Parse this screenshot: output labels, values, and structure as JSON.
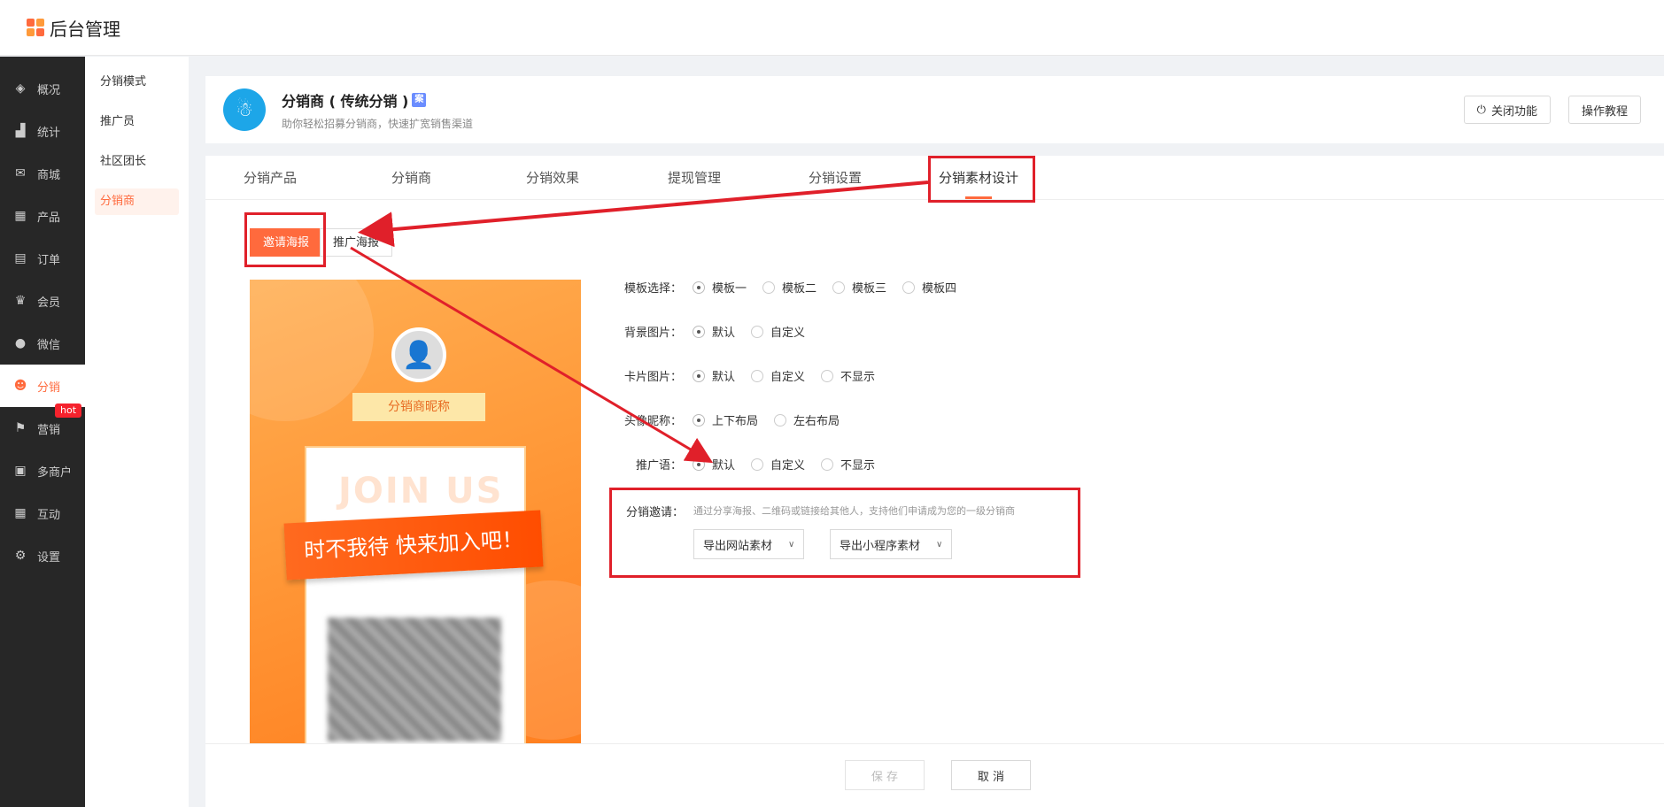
{
  "app": {
    "title": "后台管理"
  },
  "sidebar": {
    "items": [
      {
        "label": "概况",
        "icon": "layers-icon"
      },
      {
        "label": "统计",
        "icon": "chart-icon"
      },
      {
        "label": "商城",
        "icon": "mail-icon"
      },
      {
        "label": "产品",
        "icon": "grid-icon"
      },
      {
        "label": "订单",
        "icon": "clipboard-icon"
      },
      {
        "label": "会员",
        "icon": "crown-icon"
      },
      {
        "label": "微信",
        "icon": "wechat-icon"
      },
      {
        "label": "分销",
        "icon": "user-share-icon",
        "active": true
      },
      {
        "label": "营销",
        "icon": "flag-icon",
        "badge": "hot"
      },
      {
        "label": "多商户",
        "icon": "store-icon"
      },
      {
        "label": "互动",
        "icon": "grid-icon"
      },
      {
        "label": "设置",
        "icon": "gear-icon"
      }
    ]
  },
  "subnav": {
    "items": [
      {
        "label": "分销模式"
      },
      {
        "label": "推广员"
      },
      {
        "label": "社区团长"
      },
      {
        "label": "分销商",
        "active": true
      }
    ]
  },
  "header": {
    "title": "分销商 ( 传统分销 )",
    "badge": "案",
    "subtitle": "助你轻松招募分销商，快速扩宽销售渠道",
    "close_btn": "关闭功能",
    "tutorial_btn": "操作教程"
  },
  "tabs": [
    {
      "label": "分销产品"
    },
    {
      "label": "分销商"
    },
    {
      "label": "分销效果"
    },
    {
      "label": "提现管理"
    },
    {
      "label": "分销设置"
    },
    {
      "label": "分销素材设计",
      "active": true
    }
  ],
  "poster_tabs": [
    {
      "label": "邀请海报",
      "active": true
    },
    {
      "label": "推广海报"
    }
  ],
  "preview": {
    "nickname": "分销商昵称",
    "join": "JOIN US",
    "slogan": "时不我待 快来加入吧！"
  },
  "form": {
    "template": {
      "label": "模板选择：",
      "options": [
        "模板一",
        "模板二",
        "模板三",
        "模板四"
      ],
      "selected": 0
    },
    "bg_image": {
      "label": "背景图片：",
      "options": [
        "默认",
        "自定义"
      ],
      "selected": 0
    },
    "card_image": {
      "label": "卡片图片：",
      "options": [
        "默认",
        "自定义",
        "不显示"
      ],
      "selected": 0
    },
    "avatar_nick": {
      "label": "头像昵称：",
      "options": [
        "上下布局",
        "左右布局"
      ],
      "selected": 0
    },
    "slogan": {
      "label": "推广语：",
      "options": [
        "默认",
        "自定义",
        "不显示"
      ],
      "selected": 0
    },
    "invite": {
      "label": "分销邀请：",
      "desc": "通过分享海报、二维码或链接给其他人，支持他们申请成为您的一级分销商",
      "export_site": "导出网站素材",
      "export_mini": "导出小程序素材"
    }
  },
  "footer": {
    "save": "保 存",
    "cancel": "取 消"
  },
  "colors": {
    "accent": "#ff6a3d",
    "sidebar_bg": "#272727",
    "annotation": "#e0202a"
  }
}
